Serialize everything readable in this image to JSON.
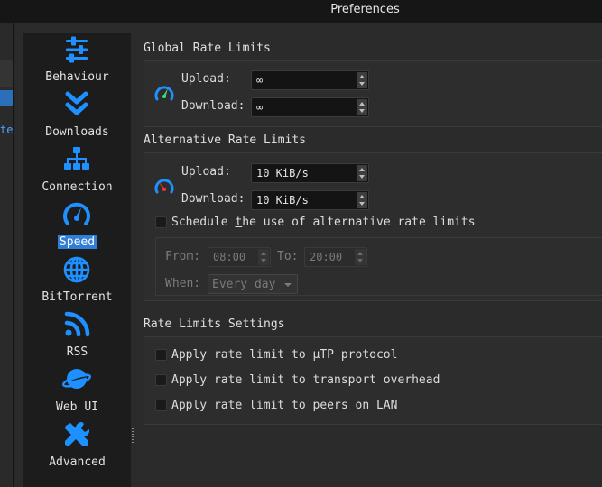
{
  "window": {
    "title": "Preferences"
  },
  "background_window": {
    "partial_text": "te"
  },
  "colors": {
    "accent": "#2f7fd8",
    "icon_blue": "#1e90ff",
    "gauge_green": "#3ddc84",
    "gauge_red": "#e53935"
  },
  "sidebar": {
    "items": [
      {
        "label": "Behaviour",
        "icon": "sliders-icon"
      },
      {
        "label": "Downloads",
        "icon": "double-chevron-down-icon"
      },
      {
        "label": "Connection",
        "icon": "network-icon"
      },
      {
        "label": "Speed",
        "icon": "speedometer-icon",
        "active": true
      },
      {
        "label": "BitTorrent",
        "icon": "globe-icon"
      },
      {
        "label": "RSS",
        "icon": "rss-icon"
      },
      {
        "label": "Web UI",
        "icon": "planet-icon"
      },
      {
        "label": "Advanced",
        "icon": "tools-icon"
      }
    ]
  },
  "global": {
    "title": "Global Rate Limits",
    "upload_label": "Upload:",
    "upload_value": "∞",
    "download_label": "Download:",
    "download_value": "∞"
  },
  "alternative": {
    "title": "Alternative Rate Limits",
    "upload_label": "Upload:",
    "upload_value": "10 KiB/s",
    "download_label": "Download:",
    "download_value": "10 KiB/s",
    "schedule_pre": "Schedule ",
    "schedule_u": "t",
    "schedule_post": "he use of alternative rate limits",
    "schedule_checked": false,
    "from_label": "From:",
    "from_value": "08:00",
    "to_label": "To:",
    "to_value": "20:00",
    "when_label": "When:",
    "when_value": "Every day"
  },
  "settings": {
    "title": "Rate Limits Settings",
    "options": [
      {
        "label": "Apply rate limit to µTP protocol",
        "checked": false
      },
      {
        "label": "Apply rate limit to transport overhead",
        "checked": false
      },
      {
        "label": "Apply rate limit to peers on LAN",
        "checked": false
      }
    ]
  }
}
